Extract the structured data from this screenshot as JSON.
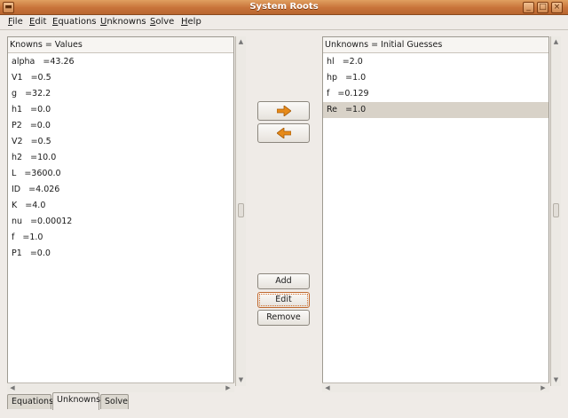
{
  "window": {
    "title": "System Roots"
  },
  "menu": [
    {
      "first": "F",
      "rest": "ile"
    },
    {
      "first": "E",
      "rest": "dit"
    },
    {
      "first": "E",
      "rest": "quations"
    },
    {
      "first": "U",
      "rest": "nknowns"
    },
    {
      "first": "S",
      "rest": "olve"
    },
    {
      "first": "H",
      "rest": "elp"
    }
  ],
  "knowns": {
    "header": "Knowns = Values",
    "rows": [
      "alpha   =43.26",
      "V1   =0.5",
      "g   =32.2",
      "h1   =0.0",
      "P2   =0.0",
      "V2   =0.5",
      "h2   =10.0",
      "L   =3600.0",
      "ID   =4.026",
      "K   =4.0",
      "nu   =0.00012",
      "f   =1.0",
      "P1   =0.0"
    ]
  },
  "unknowns": {
    "header": "Unknowns = Initial Guesses",
    "rows": [
      "hl   =2.0",
      "hp   =1.0",
      "f   =0.129",
      "Re   =1.0"
    ],
    "selected_index": 3
  },
  "buttons": {
    "add": "Add",
    "edit": "Edit",
    "remove": "Remove"
  },
  "tabs": [
    "Equations",
    "Unknowns",
    "Solve"
  ],
  "active_tab": "Unknowns",
  "colors": {
    "title_bar": "#c8733a",
    "arrow": "#e68a1a",
    "selection": "#d8d2c8"
  }
}
